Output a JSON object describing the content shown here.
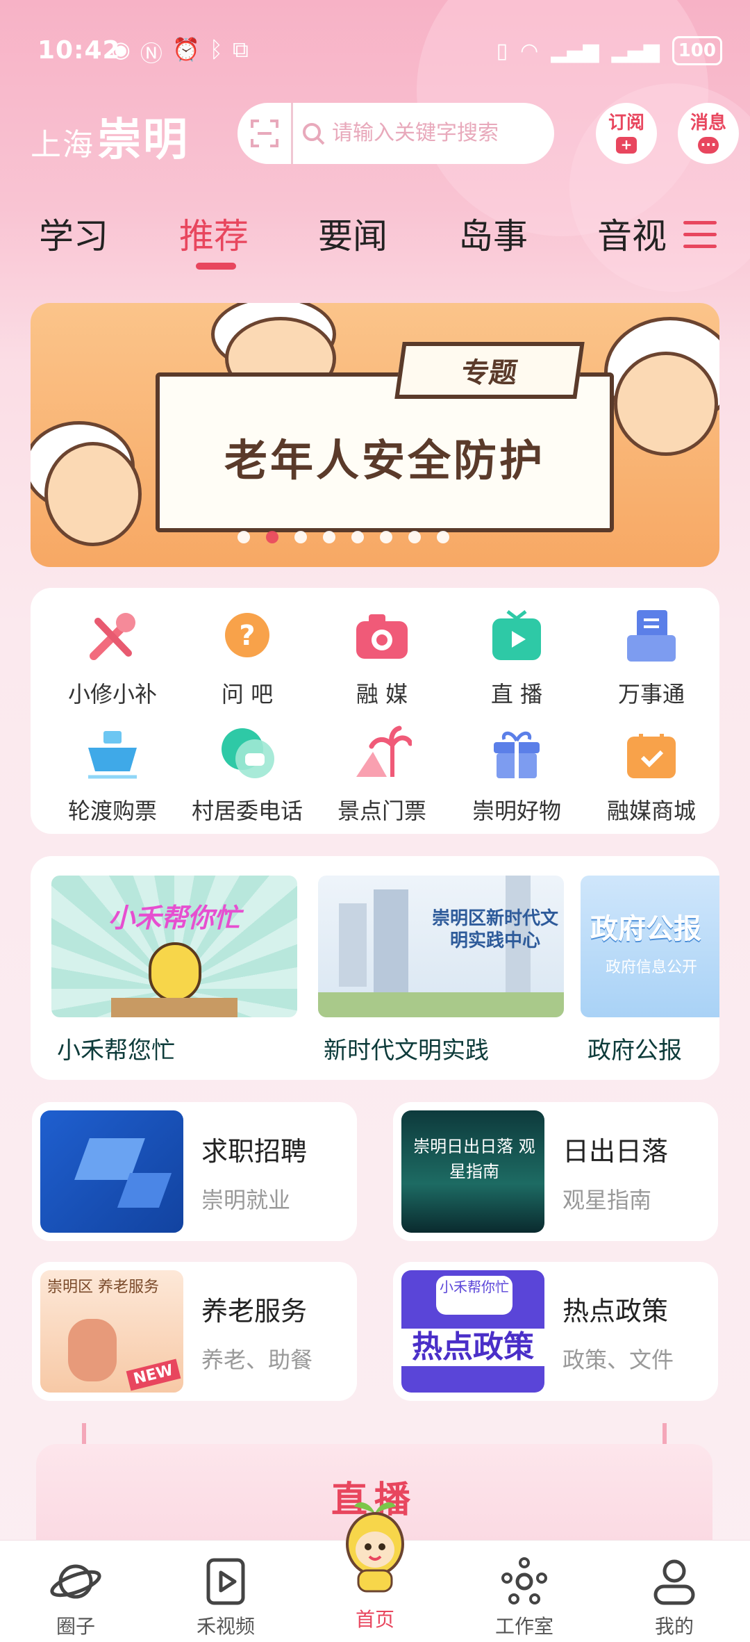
{
  "status_bar": {
    "time": "10:42",
    "battery": "100"
  },
  "header": {
    "logo_small": "上海",
    "logo_big": "崇明",
    "search_placeholder": "请输入关键字搜索",
    "subscribe_label": "订阅",
    "subscribe_badge": "+",
    "messages_label": "消息",
    "messages_badge": "···"
  },
  "tabs": [
    "学习",
    "推荐",
    "要闻",
    "岛事",
    "音视"
  ],
  "active_tab": "推荐",
  "banner": {
    "tag": "专题",
    "title": "老年人安全防护",
    "page_count": 8,
    "active_page": 2
  },
  "quick_grid": [
    {
      "label": "小修小补",
      "icon": "wrench-icon"
    },
    {
      "label": "问 吧",
      "icon": "question-icon"
    },
    {
      "label": "融 媒",
      "icon": "camera-icon"
    },
    {
      "label": "直 播",
      "icon": "tv-play-icon"
    },
    {
      "label": "万事通",
      "icon": "printer-doc-icon"
    },
    {
      "label": "轮渡购票",
      "icon": "ferry-icon"
    },
    {
      "label": "村居委电话",
      "icon": "phone-chat-icon"
    },
    {
      "label": "景点门票",
      "icon": "palm-tree-icon"
    },
    {
      "label": "崇明好物",
      "icon": "gift-icon"
    },
    {
      "label": "融媒商城",
      "icon": "shop-bag-icon"
    }
  ],
  "features": [
    {
      "label": "小禾帮您忙",
      "image_text": "小禾帮你忙"
    },
    {
      "label": "新时代文明实践",
      "image_text": "崇明区新时代文明实践中心"
    },
    {
      "label": "政府公报",
      "image_text": "政府公报",
      "image_subtext": "政府信息公开"
    }
  ],
  "services": [
    {
      "title": "求职招聘",
      "subtitle": "崇明就业"
    },
    {
      "title": "日出日落",
      "subtitle": "观星指南",
      "image_text": "崇明日出日落 观星指南"
    },
    {
      "title": "养老服务",
      "subtitle": "养老、助餐",
      "image_text": "崇明区 养老服务",
      "badge": "NEW"
    },
    {
      "title": "热点政策",
      "subtitle": "政策、文件",
      "image_text": "热点政策",
      "image_badge": "小禾帮你忙"
    }
  ],
  "live": {
    "title": "直播"
  },
  "bottom_nav": [
    "圈子",
    "禾视频",
    "首页",
    "工作室",
    "我的"
  ],
  "colors": {
    "accent": "#e8465e",
    "header_bg": "#f7b2c6",
    "page_bg": "#fbe9ee"
  }
}
